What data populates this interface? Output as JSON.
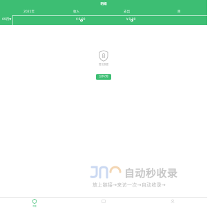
{
  "header": {
    "title": "明细",
    "year": "2021年",
    "month": "09月",
    "income_label": "收入",
    "expense_label": "支出",
    "income_value": "￥0.00",
    "expense_value": "￥0.00",
    "right_label": "目"
  },
  "empty_state": {
    "text": "暂无数据",
    "button_label": "立即记账"
  },
  "watermark": {
    "title": "自动秒收录",
    "subtitle": "放上链接→来访一次→自动收录→"
  },
  "tabbar": {
    "items": [
      {
        "label": "明细",
        "active": true
      },
      {
        "label": "",
        "active": false
      },
      {
        "label": "",
        "active": false
      }
    ]
  },
  "colors": {
    "brand": "#3dbe73"
  }
}
